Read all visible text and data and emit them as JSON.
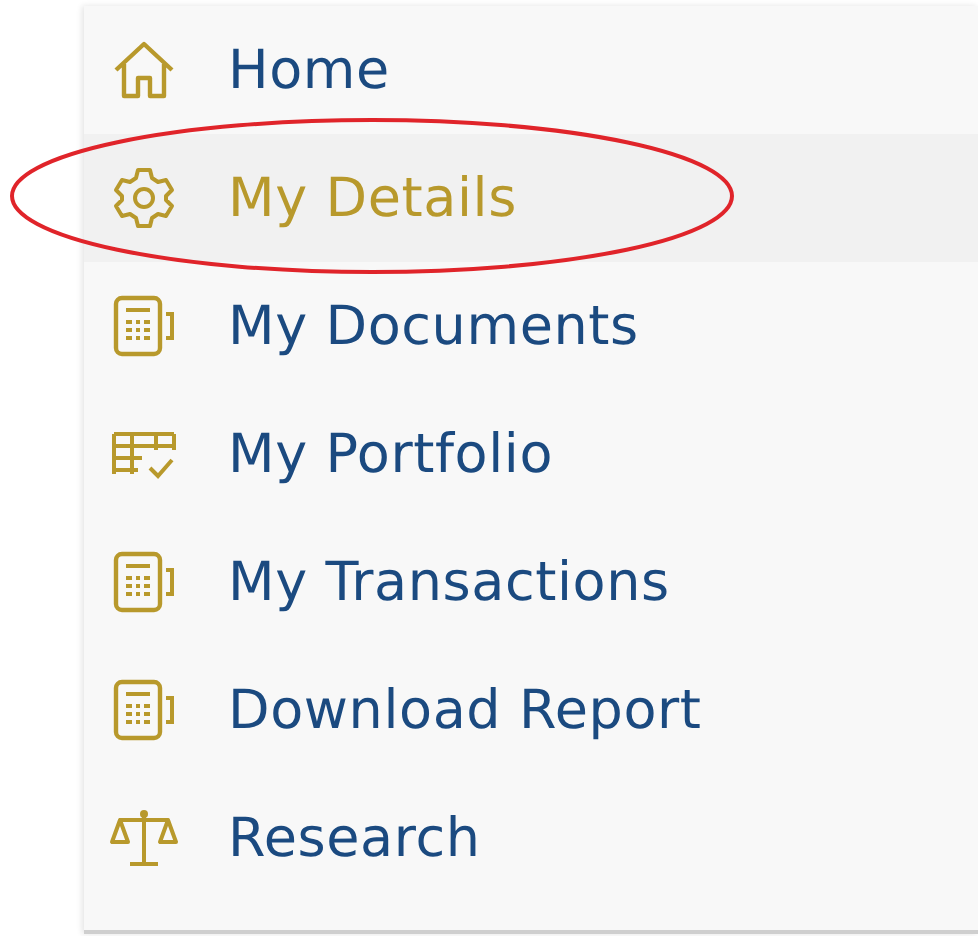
{
  "menu": {
    "items": [
      {
        "label": "Home",
        "kind": "home",
        "selected": false
      },
      {
        "label": "My Details",
        "kind": "settings",
        "selected": true
      },
      {
        "label": "My Documents",
        "kind": "calculator",
        "selected": false
      },
      {
        "label": "My Portfolio",
        "kind": "portfolio",
        "selected": false
      },
      {
        "label": "My Transactions",
        "kind": "calculator",
        "selected": false
      },
      {
        "label": "Download Report",
        "kind": "calculator",
        "selected": false
      },
      {
        "label": "Research",
        "kind": "scales",
        "selected": false
      }
    ]
  }
}
